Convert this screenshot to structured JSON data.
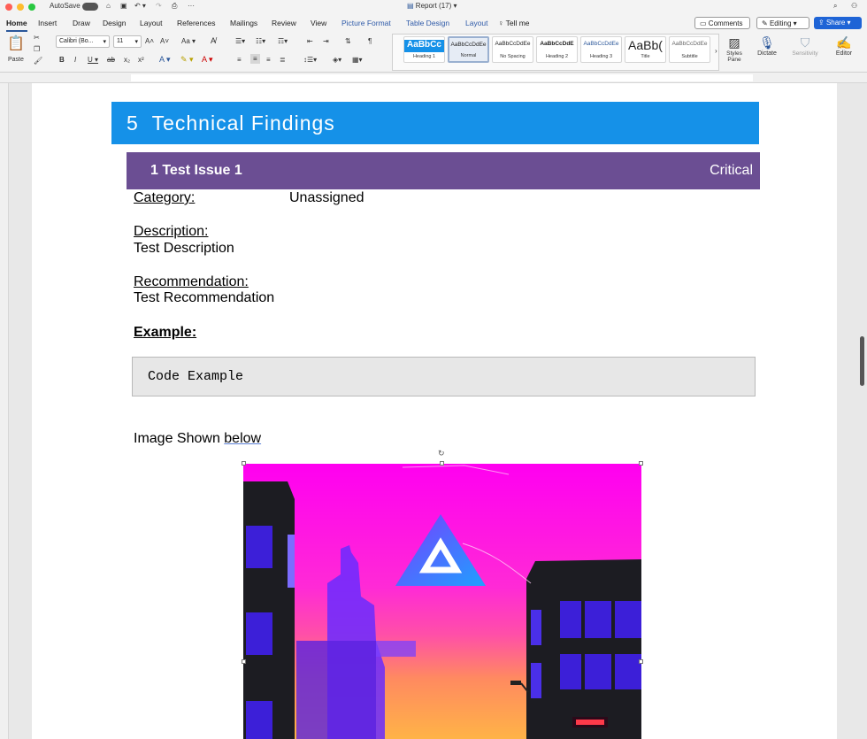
{
  "titlebar": {
    "autosave_label": "AutoSave",
    "doc_title": "Report (17)"
  },
  "tabs": [
    "Home",
    "Insert",
    "Draw",
    "Design",
    "Layout",
    "References",
    "Mailings",
    "Review",
    "View",
    "Picture Format",
    "Table Design",
    "Layout",
    "Tell me"
  ],
  "tab_actions": {
    "comments": "Comments",
    "editing": "Editing",
    "share": "Share"
  },
  "ribbon": {
    "paste": "Paste",
    "font_name": "Calibri (Bo...",
    "font_size": "11",
    "styles": [
      {
        "sample": "AaBbCc",
        "label": "Heading 1"
      },
      {
        "sample": "AaBbCcDdEe",
        "label": "Normal"
      },
      {
        "sample": "AaBbCcDdEe",
        "label": "No Spacing"
      },
      {
        "sample": "AaBbCcDdE",
        "label": "Heading 2"
      },
      {
        "sample": "AaBbCcDdEe",
        "label": "Heading 3"
      },
      {
        "sample": "AaBb(",
        "label": "Title"
      },
      {
        "sample": "AaBbCcDdEe",
        "label": "Subtitle"
      }
    ],
    "styles_pane": "Styles Pane",
    "dictate": "Dictate",
    "sensitivity": "Sensitivity",
    "editor": "Editor"
  },
  "document": {
    "section_number": "5",
    "section_title": "Technical Findings",
    "issue_title": "1 Test Issue 1",
    "severity": "Critical",
    "category_label": "Category:",
    "category_value": "Unassigned",
    "description_label": "Description:",
    "description_value": "Test Description",
    "recommendation_label": "Recommendation:",
    "recommendation_value": "Test Recommendation",
    "example_label": "Example:",
    "code": "Code Example",
    "image_caption_prefix": "Image Shown ",
    "image_caption_link": "below"
  },
  "colors": {
    "heading1_bg": "#1591e8",
    "heading2_bg": "#6b4e93",
    "accent": "#2b579a",
    "share_btn": "#1e64d6"
  }
}
